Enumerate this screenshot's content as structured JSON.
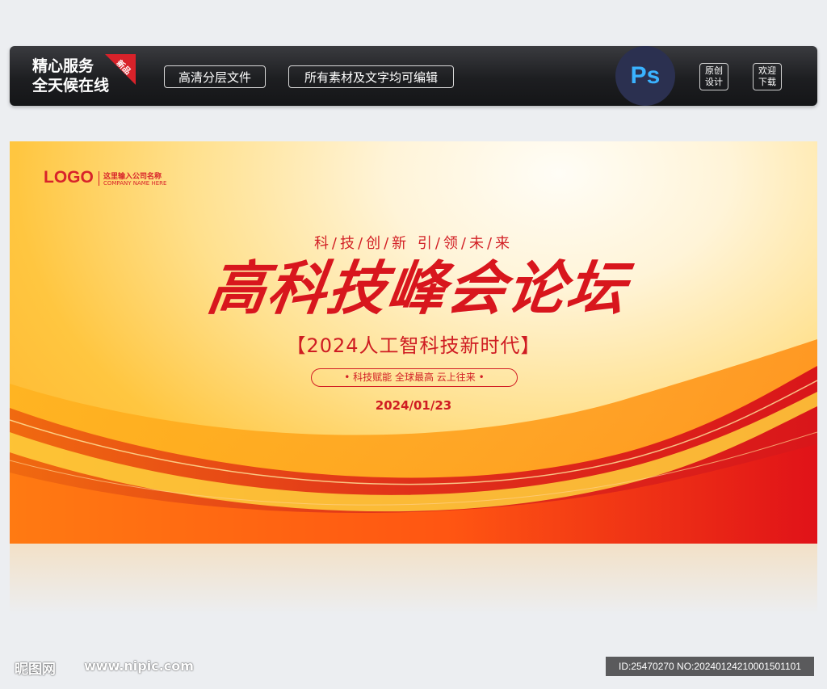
{
  "header": {
    "service_line1": "精心服务",
    "service_line2": "全天候在线",
    "new_badge": "新品",
    "pill1": "高清分层文件",
    "pill2": "所有素材及文字均可编辑",
    "ps_label": "Ps",
    "box1_line1": "原创",
    "box1_line2": "设计",
    "box2_line1": "欢迎",
    "box2_line2": "下载",
    "ps_color": "#3ab2ff"
  },
  "banner": {
    "logo": "LOGO",
    "company_cn": "这里输入公司名称",
    "company_en": "COMPANY NAME HERE",
    "slogan": "科/技/创/新 引/领/未/来",
    "title": "高科技峰会论坛",
    "subtitle": "【2024人工智科技新时代】",
    "tagline": "• 科技赋能 全球最高 云上往来 •",
    "date": "2024/01/23",
    "accent_color": "#d8161d"
  },
  "watermark": {
    "site_cn": "昵图网",
    "site_url": "www.nipic.com",
    "id_text": "ID:25470270 NO:20240124210001501101"
  }
}
